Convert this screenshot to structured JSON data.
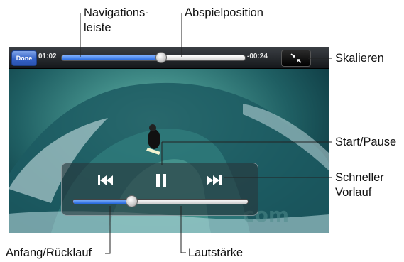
{
  "player": {
    "done_label": "Done",
    "elapsed": "01:02",
    "remaining": "-00:24",
    "playback_progress": 0.54,
    "volume_level": 0.33,
    "watermark": "com"
  },
  "callouts": {
    "navigation_line1": "Navigations-",
    "navigation_line2": "leiste",
    "playhead": "Abspielposition",
    "scale": "Skalieren",
    "play_pause": "Start/Pause",
    "fast_forward_line1": "Schneller",
    "fast_forward_line2": "Vorlauf",
    "rewind": "Anfang/Rücklauf",
    "volume": "Lautstärke"
  },
  "colors": {
    "accent_blue": "#2466dd",
    "done_button": "#3563c7",
    "bar_dark": "#15181b"
  },
  "icons": [
    "scale-icon",
    "previous-icon",
    "pause-icon",
    "next-icon"
  ]
}
